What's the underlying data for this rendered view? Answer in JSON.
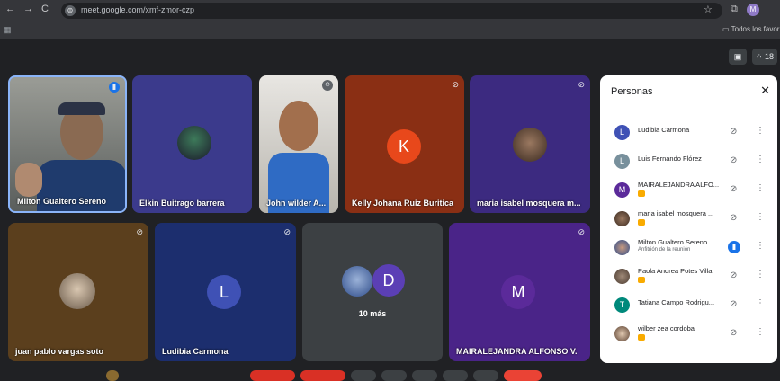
{
  "browser": {
    "url": "meet.google.com/xmf-zmor-czp",
    "bookmark_folder": "Todos los favoritos",
    "profile_initial": "M",
    "participant_count": "18"
  },
  "tiles": [
    {
      "name": "Milton Gualtero Sereno"
    },
    {
      "name": "Elkin Buitrago barrera"
    },
    {
      "name": "John wilder A..."
    },
    {
      "name": "Kelly Johana Ruiz Buritica",
      "initial": "K"
    },
    {
      "name": "maria isabel mosquera m..."
    },
    {
      "name": "juan pablo vargas soto"
    },
    {
      "name": "Ludibia Carmona",
      "initial": "L"
    },
    {
      "name": "10 más",
      "initial": "D"
    },
    {
      "name": "MAIRALEJANDRA ALFONSO V.",
      "initial": "M"
    }
  ],
  "panel": {
    "title": "Personas",
    "people": [
      {
        "name": "Ludibia Carmona",
        "initial": "L"
      },
      {
        "name": "Luis Fernando Flórez",
        "initial": "L"
      },
      {
        "name": "MAIRALEJANDRA ALFO...",
        "initial": "M"
      },
      {
        "name": "maria isabel mosquera ..."
      },
      {
        "name": "Milton Gualtero Sereno",
        "sub": "Anfitrión de la reunión"
      },
      {
        "name": "Paola Andrea Potes Villa"
      },
      {
        "name": "Tatiana Campo Rodrigu...",
        "initial": "T"
      },
      {
        "name": "wilber zea cordoba"
      }
    ]
  },
  "colors": {
    "kelly": "#e8481b",
    "ludibia_tile": "#3f51b5",
    "more_tile": "#3c4043",
    "mairalejandra_tile": "#5b2a9a"
  }
}
